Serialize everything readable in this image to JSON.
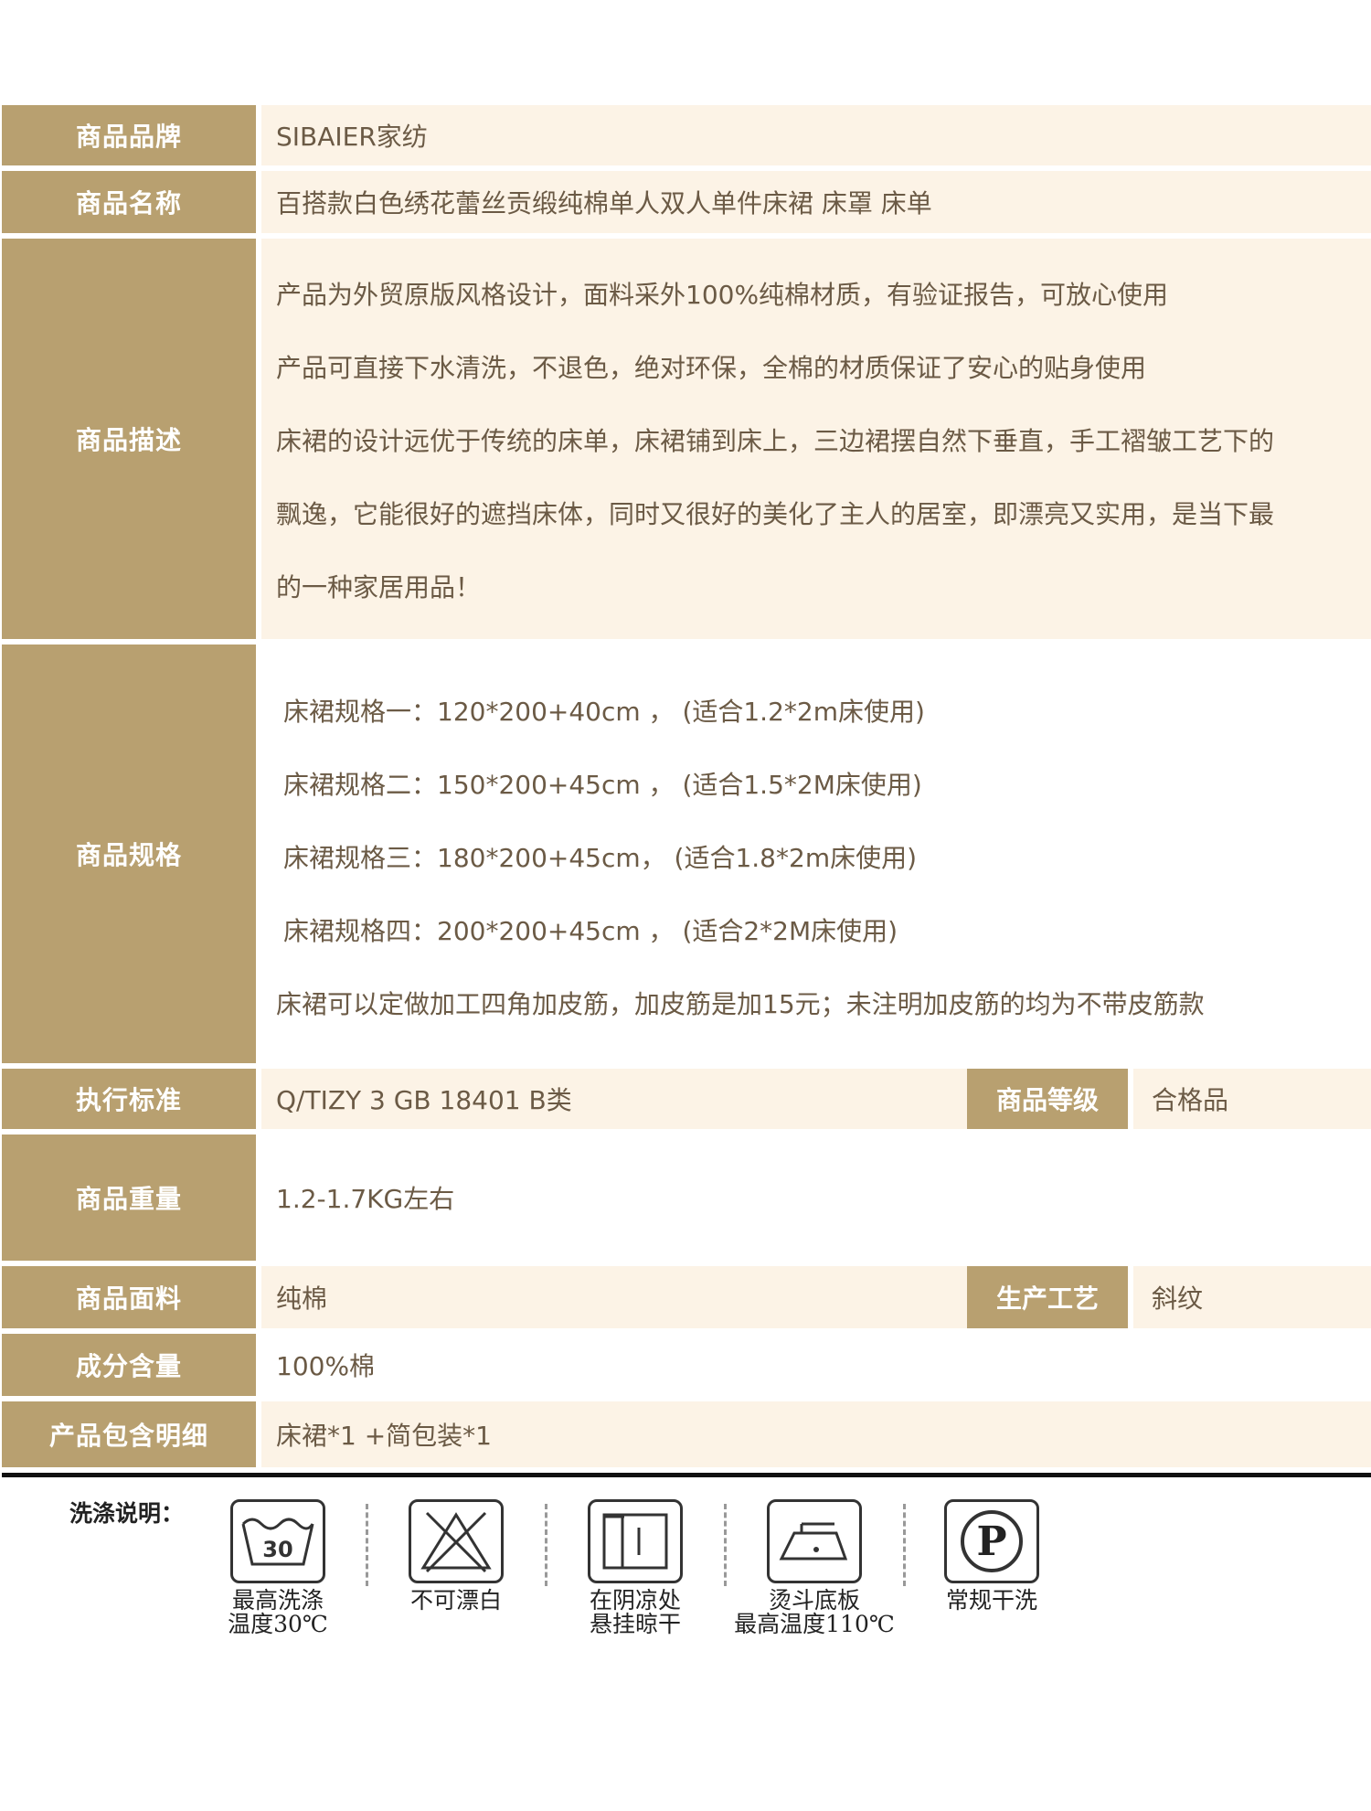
{
  "rows": {
    "brand": {
      "label": "商品品牌",
      "value": "SIBAIER家纺"
    },
    "name": {
      "label": "商品名称",
      "value": "百搭款白色绣花蕾丝贡缎纯棉单人双人单件床裙 床罩 床单"
    },
    "desc": {
      "label": "商品描述",
      "lines": [
        "产品为外贸原版风格设计，面料采外100%纯棉材质，有验证报告，可放心使用",
        "产品可直接下水清洗，不退色，绝对环保，全棉的材质保证了安心的贴身使用",
        "床裙的设计远优于传统的床单，床裙铺到床上，三边裙摆自然下垂直，手工褶皱工艺下的",
        "飘逸，它能很好的遮挡床体，同时又很好的美化了主人的居室，即漂亮又实用，是当下最",
        "的一种家居用品！"
      ]
    },
    "spec": {
      "label": "商品规格",
      "lines": [
        "床裙规格一：120*200+40cm ，  (适合1.2*2m床使用)",
        "床裙规格二：150*200+45cm ，  (适合1.5*2M床使用)",
        "床裙规格三：180*200+45cm，   (适合1.8*2m床使用)",
        "床裙规格四：200*200+45cm  ，   (适合2*2M床使用)",
        "床裙可以定做加工四角加皮筋，加皮筋是加15元；未注明加皮筋的均为不带皮筋款"
      ]
    },
    "standard": {
      "label": "执行标准",
      "value": "Q/TIZY 3 GB 18401 B类",
      "label2": "商品等级",
      "value2": "合格品"
    },
    "weight": {
      "label": "商品重量",
      "value": "1.2-1.7KG左右"
    },
    "fabric": {
      "label": "商品面料",
      "value": "纯棉",
      "label2": "生产工艺",
      "value2": "斜纹"
    },
    "content": {
      "label": "成分含量",
      "value": "100%棉"
    },
    "package": {
      "label": "产品包含明细",
      "value": "床裙*1 +简包装*1"
    }
  },
  "wash": {
    "title": "洗涤说明：",
    "items": [
      {
        "icon": "wash-30-icon",
        "number": "30",
        "caption": [
          "最高洗涤",
          "温度30℃"
        ]
      },
      {
        "icon": "no-bleach-icon",
        "caption": [
          "不可漂白"
        ]
      },
      {
        "icon": "shade-hang-dry-icon",
        "caption": [
          "在阴凉处",
          "悬挂晾干"
        ]
      },
      {
        "icon": "iron-110-icon",
        "caption": [
          "烫斗底板",
          "最高温度110℃"
        ]
      },
      {
        "icon": "dry-clean-p-icon",
        "letter": "P",
        "caption": [
          "常规干洗"
        ]
      }
    ]
  }
}
